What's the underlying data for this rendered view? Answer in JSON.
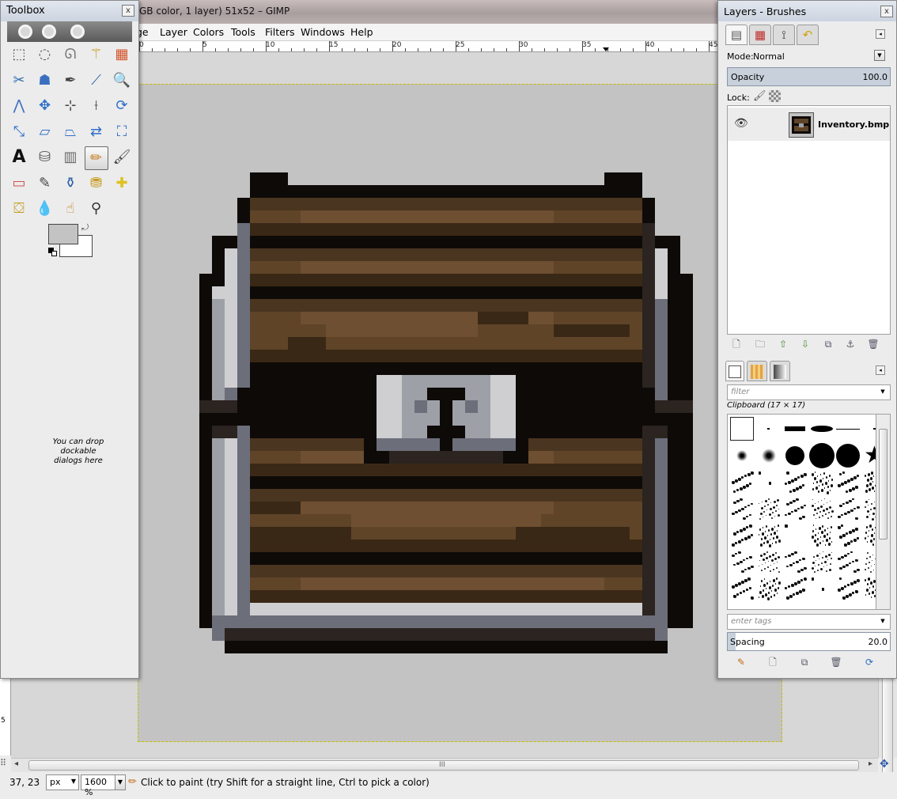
{
  "main_window": {
    "title": "GB color, 1 layer) 51x52 – GIMP",
    "menus": [
      {
        "label": "ge"
      },
      {
        "label": "Layer"
      },
      {
        "label": "Colors"
      },
      {
        "label": "Tools"
      },
      {
        "label": "Filters"
      },
      {
        "label": "Windows"
      },
      {
        "label": "Help"
      }
    ],
    "ruler_labels": [
      "0",
      "5",
      "10",
      "15",
      "20",
      "25",
      "30",
      "35",
      "40",
      "45"
    ],
    "left_ruler_label": "5",
    "scroll_grip": "III"
  },
  "statusbar": {
    "coords": "37, 23",
    "unit": "px",
    "zoom": "1600 %",
    "message": "Click to paint (try Shift for a straight line, Ctrl to pick a color)"
  },
  "toolbox": {
    "title": "Toolbox",
    "close": "x",
    "drop_hint": "You can drop dockable dialogs here",
    "tools": [
      {
        "name": "rect-select-tool",
        "glyph": "⬚",
        "color": "#555"
      },
      {
        "name": "ellipse-select-tool",
        "glyph": "◌",
        "color": "#555"
      },
      {
        "name": "free-select-tool",
        "glyph": "ᘏ",
        "color": "#777"
      },
      {
        "name": "fuzzy-select-tool",
        "glyph": "⚚",
        "color": "#c59a1d"
      },
      {
        "name": "select-by-color-tool",
        "glyph": "▦",
        "color": "#d2552a"
      },
      {
        "name": "scissors-tool",
        "glyph": "✂",
        "color": "#2f6fb3"
      },
      {
        "name": "foreground-select-tool",
        "glyph": "☗",
        "color": "#3a6fc0"
      },
      {
        "name": "paths-tool",
        "glyph": "✒",
        "color": "#444"
      },
      {
        "name": "color-picker-tool",
        "glyph": "⟋",
        "color": "#2a5ea8"
      },
      {
        "name": "zoom-tool",
        "glyph": "🔍",
        "color": "#3a6fc0"
      },
      {
        "name": "measure-tool",
        "glyph": "⋀",
        "color": "#3a6fc0"
      },
      {
        "name": "move-tool",
        "glyph": "✥",
        "color": "#2f6fc8"
      },
      {
        "name": "align-tool",
        "glyph": "⊹",
        "color": "#444"
      },
      {
        "name": "crop-tool",
        "glyph": "⟊",
        "color": "#555"
      },
      {
        "name": "rotate-tool",
        "glyph": "⟳",
        "color": "#2f6fc8"
      },
      {
        "name": "scale-tool",
        "glyph": "⤡",
        "color": "#2f6fc8"
      },
      {
        "name": "shear-tool",
        "glyph": "▱",
        "color": "#2f6fc8"
      },
      {
        "name": "perspective-tool",
        "glyph": "⏢",
        "color": "#2f6fc8"
      },
      {
        "name": "flip-tool",
        "glyph": "⇄",
        "color": "#2f6fc8"
      },
      {
        "name": "cage-transform-tool",
        "glyph": "⛶",
        "color": "#2f6fc8"
      },
      {
        "name": "text-tool",
        "glyph": "A",
        "color": "#111"
      },
      {
        "name": "bucket-fill-tool",
        "glyph": "⛁",
        "color": "#555"
      },
      {
        "name": "blend-tool",
        "glyph": "▥",
        "color": "#666"
      },
      {
        "name": "pencil-tool",
        "glyph": "✏",
        "color": "#c47a1a"
      },
      {
        "name": "paintbrush-tool",
        "glyph": "🖌",
        "color": "#444"
      },
      {
        "name": "eraser-tool",
        "glyph": "▭",
        "color": "#d05050"
      },
      {
        "name": "airbrush-tool",
        "glyph": "✎",
        "color": "#444"
      },
      {
        "name": "ink-tool",
        "glyph": "⚱",
        "color": "#2a5ea8"
      },
      {
        "name": "clone-tool",
        "glyph": "⛃",
        "color": "#c59a1d"
      },
      {
        "name": "heal-tool",
        "glyph": "✚",
        "color": "#e0c020"
      },
      {
        "name": "perspective-clone-tool",
        "glyph": "⛋",
        "color": "#c59a1d"
      },
      {
        "name": "blur-tool",
        "glyph": "💧",
        "color": "#3a6fc0"
      },
      {
        "name": "smudge-tool",
        "glyph": "☝",
        "color": "#c47a1a"
      },
      {
        "name": "dodge-burn-tool",
        "glyph": "⚲",
        "color": "#333"
      }
    ],
    "fg_color": "#c3c3c3",
    "bg_color": "#ffffff"
  },
  "dock": {
    "title": "Layers - Brushes",
    "close": "x",
    "mode_label": "Mode:",
    "mode_value": "Normal",
    "opacity_label": "Opacity",
    "opacity_value": "100.0",
    "lock_label": "Lock:",
    "layer_name": "Inventory.bmp",
    "filter_placeholder": "filter",
    "brush_name": "Clipboard (17 × 17)",
    "tags_placeholder": "enter tags",
    "spacing_label": "Spacing",
    "spacing_value": "20.0"
  },
  "chest": {
    "palette": {
      "k": "#0e0a08",
      "a": "#2b2420",
      "g": "#6c6e7a",
      "s": "#9ea0a8",
      "w": "#cfcfd2",
      "d": "#4a3520",
      "m": "#5f4428",
      "l": "#6e4f31",
      "x": "#3a2816",
      "c": "#c3c3c3"
    }
  }
}
